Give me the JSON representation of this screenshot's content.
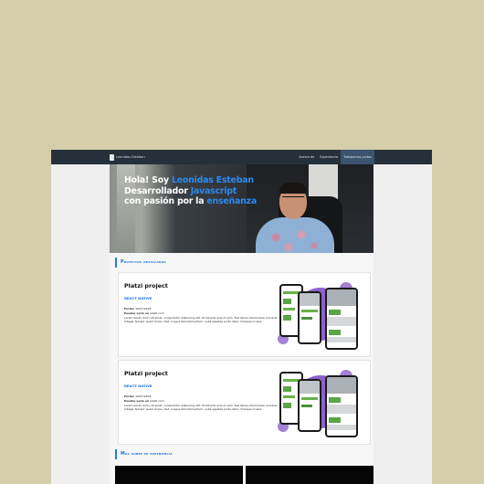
{
  "header": {
    "brand": "Leonidas Esteban",
    "nav": [
      "Acerca de",
      "Experiencia",
      "Trabajemos juntos"
    ],
    "active_nav": "Trabajemos juntos"
  },
  "hero": {
    "line1_a": "Hola! Soy ",
    "line1_b": "Leonidas Esteban",
    "line2_a": "Desarrollador ",
    "line2_b": "Javascript",
    "line3_a": "con pasión por la ",
    "line3_b": "enseñanza"
  },
  "projects": {
    "title": "Proyectos destacados",
    "items": [
      {
        "title": "Platzi project",
        "tag": "REACT NATIVE",
        "fecha_label": "Fecha:",
        "fecha": "10/07/2018",
        "url_label": "Puedes verlo en",
        "url": "platzi.com",
        "description": "Lorem ipsum dolor sit amet, consectetur adipiscing elit. Ut lobortis quis ut sem. Sed tellus ullamcorper pulvinar. Integer tempor quam turpis. Sed congue felis fermentum, nulla egestas porta diam. Quisque ornare."
      },
      {
        "title": "Platzi project",
        "tag": "REACT NATIVE",
        "fecha_label": "Fecha:",
        "fecha": "10/07/2018",
        "url_label": "Puedes verlo en",
        "url": "platzi.com",
        "description": "Lorem ipsum dolor sit amet, consectetur adipiscing elit. Ut lobortis quis ut sem. Sed tellus ullamcorper pulvinar. Integer tempor quam turpis. Sed congue felis fermentum, nulla egestas porta diam. Quisque ornare."
      }
    ]
  },
  "experience": {
    "title": "Más sobre mi experiencia"
  },
  "colors": {
    "accent": "#1f7ae6",
    "navbar": "#25303b",
    "purple": "#8c63c9"
  }
}
